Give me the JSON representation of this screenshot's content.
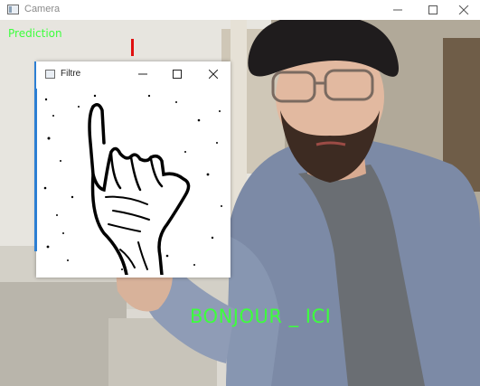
{
  "window": {
    "title": "Camera",
    "controls": [
      "minimize",
      "maximize",
      "close"
    ]
  },
  "overlay": {
    "prediction_label": "Prediction",
    "result_text": "BONJOUR _ ICI"
  },
  "filter_window": {
    "title": "Filtre",
    "controls": [
      "minimize",
      "maximize",
      "close"
    ]
  },
  "colors": {
    "overlay_text": "#3dff3d",
    "marker": "#e01010",
    "accent": "#2d7fd3"
  }
}
